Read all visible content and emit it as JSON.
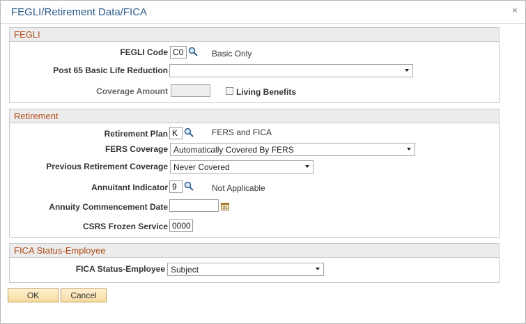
{
  "dialog": {
    "title": "FEGLI/Retirement Data/FICA",
    "close_label": "×"
  },
  "fegli": {
    "header": "FEGLI",
    "code_label": "FEGLI Code",
    "code_value": "C0",
    "code_desc": "Basic Only",
    "post65_label": "Post 65 Basic Life Reduction",
    "post65_value": "",
    "coverage_amount_label": "Coverage Amount",
    "coverage_amount_value": "",
    "living_benefits_label": "Living Benefits"
  },
  "retirement": {
    "header": "Retirement",
    "plan_label": "Retirement Plan",
    "plan_value": "K",
    "plan_desc": "FERS and FICA",
    "fers_label": "FERS Coverage",
    "fers_value": "Automatically Covered By FERS",
    "prev_label": "Previous Retirement Coverage",
    "prev_value": "Never Covered",
    "annuitant_label": "Annuitant Indicator",
    "annuitant_value": "9",
    "annuitant_desc": "Not Applicable",
    "annuity_date_label": "Annuity Commencement Date",
    "annuity_date_value": "",
    "csrs_label": "CSRS Frozen Service",
    "csrs_value": "0000"
  },
  "fica": {
    "header": "FICA Status-Employee",
    "status_label": "FICA Status-Employee",
    "status_value": "Subject"
  },
  "buttons": {
    "ok": "OK",
    "cancel": "Cancel"
  }
}
